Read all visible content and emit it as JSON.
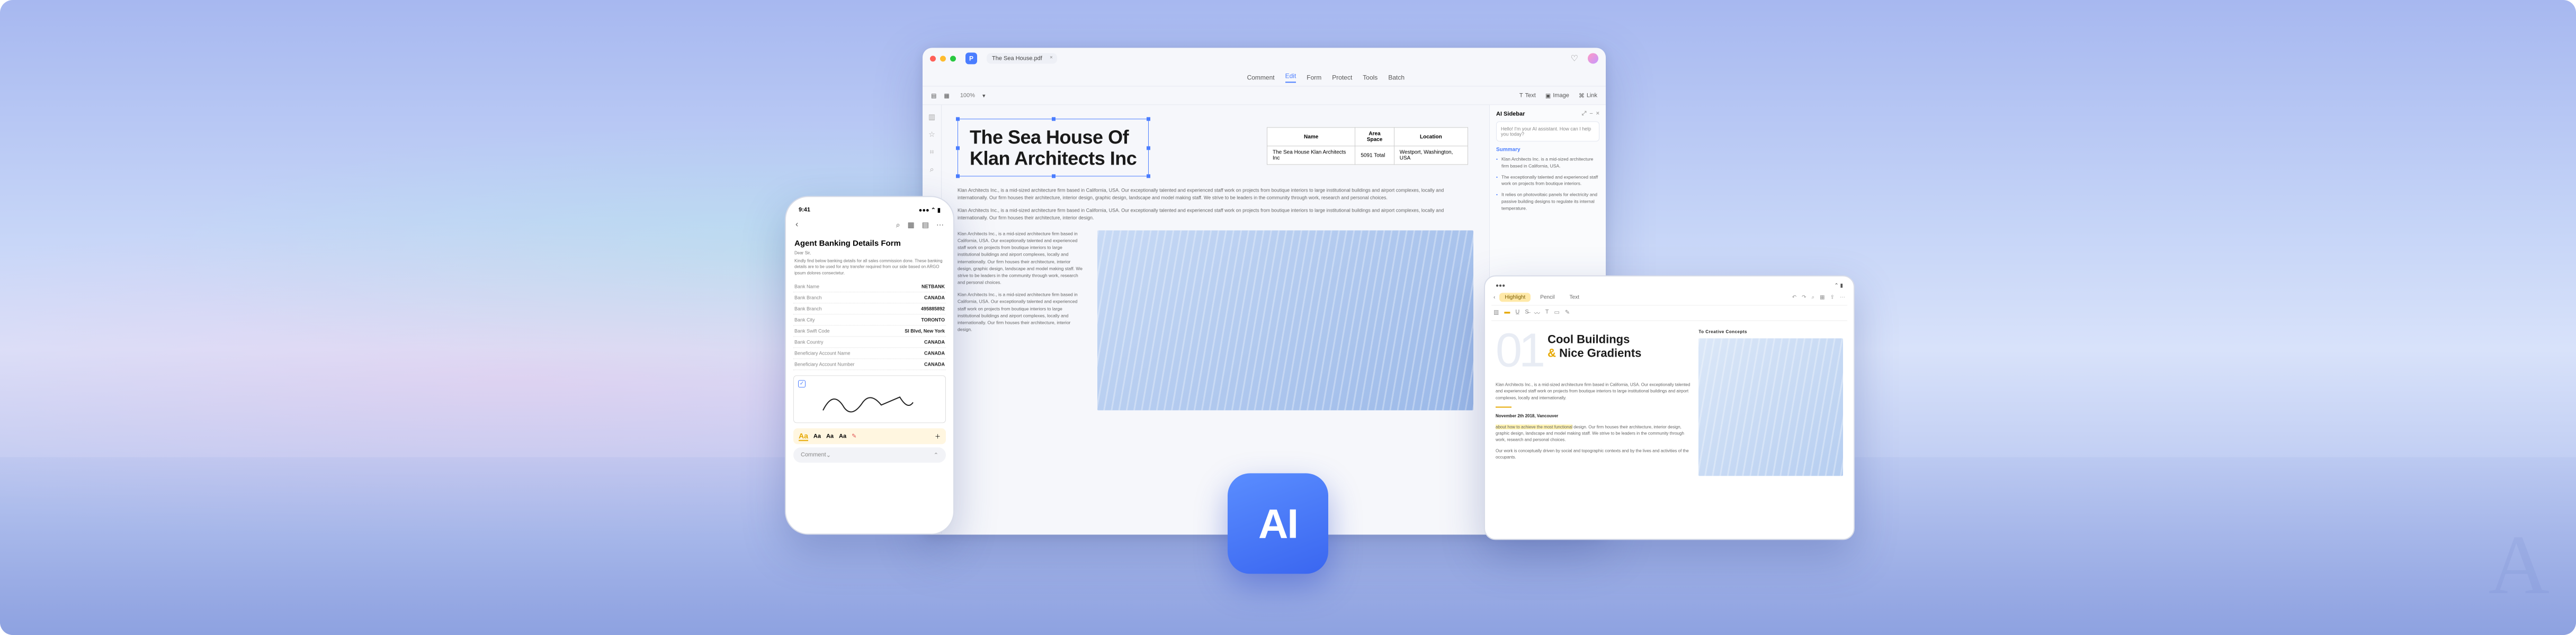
{
  "desktop": {
    "document_tab": "The Sea House.pdf",
    "menu": {
      "comment": "Comment",
      "edit": "Edit",
      "form": "Form",
      "protect": "Protect",
      "tools": "Tools",
      "batch": "Batch"
    },
    "zoom": "100%",
    "toolbtns": {
      "text": "Text",
      "image": "Image",
      "link": "Link"
    },
    "headline_l1": "The Sea House Of",
    "headline_l2": "Klan Architects Inc",
    "table": {
      "headers": {
        "name": "Name",
        "area": "Area Space",
        "location": "Location"
      },
      "row": {
        "name": "The Sea House Klan Architects Inc",
        "area": "5091 Total",
        "location": "Westport, Washington, USA"
      }
    },
    "para1": "Klan Architects Inc., is a mid-sized architecture firm based in California, USA. Our exceptionally talented and experienced staff work on projects from boutique interiors to large institutional buildings and airport complexes, locally and internationally. Our firm houses their architecture, interior design, graphic design, landscape and model making staff. We strive to be leaders in the community through work, research and personal choices.",
    "para2": "Klan Architects Inc., is a mid-sized architecture firm based in California, USA. Our exceptionally talented and experienced staff work on projects from boutique interiors to large institutional buildings and airport complexes, locally and internationally. Our firm houses their architecture, interior design.",
    "col1": "Klan Architects Inc., is a mid-sized architecture firm based in California, USA. Our exceptionally talented and experienced staff work on projects from boutique interiors to large institutional buildings and airport complexes, locally and internationally. Our firm houses their architecture, interior design, graphic design, landscape and model making staff. We strive to be leaders in the community through work, research and personal choices.",
    "col2": "Klan Architects Inc., is a mid-sized architecture firm based in California, USA. Our exceptionally talented and experienced staff work on projects from boutique interiors to large institutional buildings and airport complexes, locally and internationally. Our firm houses their architecture, interior design.",
    "sidebar": {
      "title": "AI Sidebar",
      "prompt": "Hello! I'm your AI assistant. How can I help you today?",
      "section": "Summary",
      "b1": "Klan Architects Inc. is a mid-sized architecture firm based in California, USA.",
      "b2": "The exceptionally talented and experienced staff work on projects from boutique interiors.",
      "b3": "It relies on photovoltaic panels for electricity and passive building designs to regulate its internal temperature."
    }
  },
  "phone": {
    "time": "9:41",
    "title": "Agent Banking Details Form",
    "greeting": "Dear Sir,",
    "intro": "Kindly find below banking details for all sales commission done. These banking details are to be used for any transfer required from our side based on ARGO ipsum dolores consectetur.",
    "rows": [
      {
        "label": "Bank Name",
        "value": "NETBANK"
      },
      {
        "label": "Bank Branch",
        "value": "CANADA"
      },
      {
        "label": "Bank Branch",
        "value": "495885892"
      },
      {
        "label": "Bank City",
        "value": "TORONTO"
      },
      {
        "label": "Bank Swift Code",
        "value": "SI Blvd, New York"
      },
      {
        "label": "Bank Country",
        "value": "CANADA"
      },
      {
        "label": "Beneficiary Account Name",
        "value": "CANADA"
      },
      {
        "label": "Beneficiary Account Number",
        "value": "CANADA"
      }
    ],
    "format_labels": [
      "Aa",
      "Aa",
      "Aa",
      "Aa"
    ],
    "comment_placeholder": "Comment"
  },
  "tablet": {
    "tabs": {
      "highlight": "Highlight",
      "pencil": "Pencil",
      "text": "Text"
    },
    "bignum": "01",
    "headline_l1": "Cool Buildings",
    "headline_l2": "Nice Gradients",
    "right_label": "To Creative Concepts",
    "body1": "Klan Architects Inc., is a mid-sized architecture firm based in California, USA. Our exceptionally talented and experienced staff work on projects from boutique interiors to large institutional buildings and airport complexes, locally and internationally.",
    "date": "November 2th 2018, Vancouver",
    "body2a": "about how to achieve the most functional",
    "body2b": "design. Our firm houses their architecture, interior design, graphic design, landscape and model making staff. We strive to be leaders in the community through work, research and personal choices.",
    "body3": "Our work is conceptually driven by social and topographic contexts and by the lives and activities of the occupants."
  },
  "ai_label": "AI",
  "watermark": "A"
}
